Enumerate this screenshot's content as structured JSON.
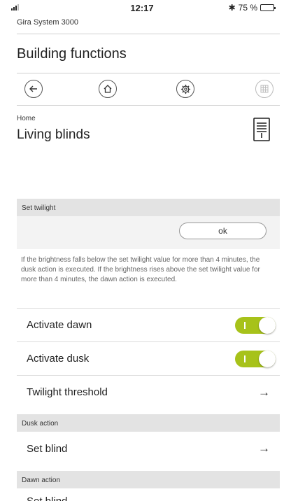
{
  "status": {
    "time": "12:17",
    "battery": "75 %",
    "battery_level": 0.75
  },
  "app_name": "Gira System 3000",
  "page_title": "Building functions",
  "nav": {
    "back": "back-icon",
    "home": "home-icon",
    "settings": "gear-icon",
    "grid": "grid-icon"
  },
  "breadcrumb": "Home",
  "room_title": "Living blinds",
  "sections": {
    "twilight": {
      "header": "Set twilight",
      "ok_label": "ok",
      "info": "If the brightness falls below the set twilight value for more than 4 minutes, the dusk action is executed. If the brightness rises above the set twilight value for more than 4 minutes, the dawn action is executed."
    },
    "dusk_header": "Dusk action",
    "dawn_header": "Dawn action"
  },
  "rows": {
    "activate_dawn": {
      "label": "Activate dawn",
      "on": true
    },
    "activate_dusk": {
      "label": "Activate dusk",
      "on": true
    },
    "twilight_threshold": {
      "label": "Twilight threshold"
    },
    "set_blind_dusk": {
      "label": "Set blind"
    },
    "set_blind_dawn": {
      "label": "Set blind"
    }
  },
  "colors": {
    "accent": "#a7c21a",
    "section_header": "#e3e3e3"
  }
}
